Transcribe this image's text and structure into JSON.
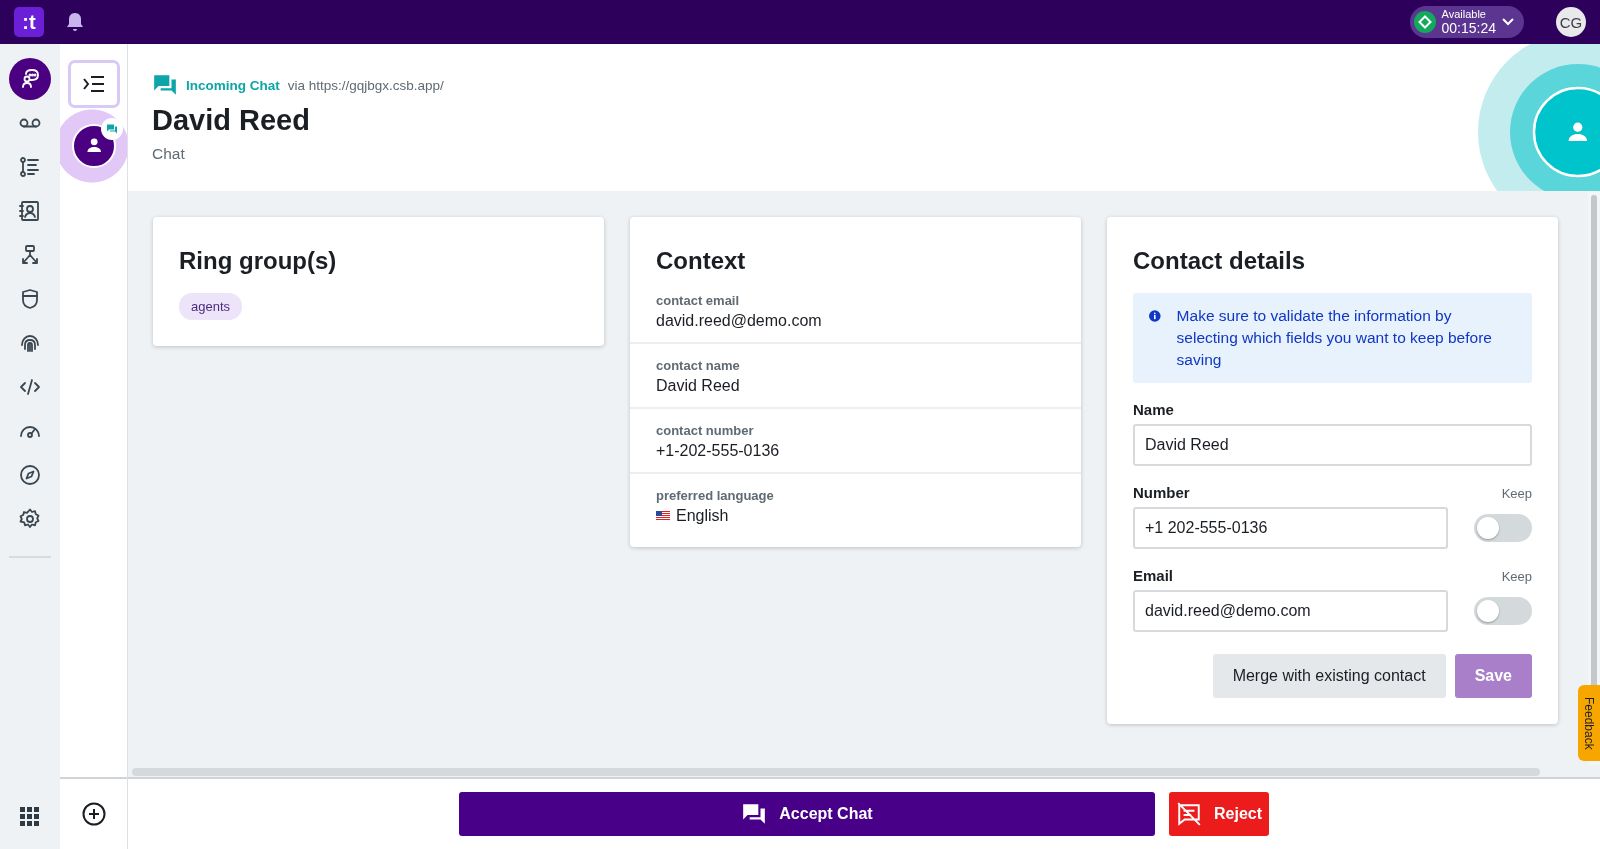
{
  "topbar": {
    "logo": ":t",
    "status": {
      "label": "Available",
      "time": "00:15:24"
    },
    "user_initials": "CG"
  },
  "nav_items": [
    {
      "kind": "agent",
      "selected": true
    },
    {
      "kind": "voicemail",
      "selected": false
    },
    {
      "kind": "list",
      "selected": false
    },
    {
      "kind": "contacts",
      "selected": false
    },
    {
      "kind": "flow",
      "selected": false
    },
    {
      "kind": "shield",
      "selected": false
    },
    {
      "kind": "fingerprint",
      "selected": false
    },
    {
      "kind": "code",
      "selected": false
    },
    {
      "kind": "gauge",
      "selected": false
    },
    {
      "kind": "compass",
      "selected": false
    },
    {
      "kind": "settings",
      "selected": false
    }
  ],
  "queue": [
    {
      "selected": true
    }
  ],
  "header": {
    "channel": "Incoming Chat",
    "via": "via https://gqjbgx.csb.app/",
    "name": "David Reed",
    "subtitle": "Chat"
  },
  "ring_groups": {
    "title": "Ring group(s)",
    "tags": [
      "agents"
    ]
  },
  "context": {
    "title": "Context",
    "rows": [
      {
        "kind": "text",
        "label": "contact email",
        "value": "david.reed@demo.com"
      },
      {
        "kind": "text",
        "label": "contact name",
        "value": "David Reed"
      },
      {
        "kind": "text",
        "label": "contact number",
        "value": "+1-202-555-0136"
      },
      {
        "kind": "language",
        "label": "preferred language",
        "value": "English"
      }
    ]
  },
  "contact_details": {
    "title": "Contact details",
    "notice": "Make sure to validate the information by selecting which fields you want to keep before saving",
    "fields": [
      {
        "label": "Name",
        "value": "David Reed"
      },
      {
        "label": "Number",
        "value": "+1 202-555-0136",
        "keep_label": "Keep",
        "keep": false
      },
      {
        "label": "Email",
        "value": "david.reed@demo.com",
        "keep_label": "Keep",
        "keep": false
      }
    ],
    "buttons": [
      {
        "label": "Merge with existing contact",
        "kind": "secondary"
      },
      {
        "label": "Save",
        "kind": "primary"
      }
    ]
  },
  "actions": [
    {
      "label": "Accept Chat",
      "kind": "accept"
    },
    {
      "label": "Reject",
      "kind": "reject"
    }
  ],
  "feedback": "Feedback"
}
